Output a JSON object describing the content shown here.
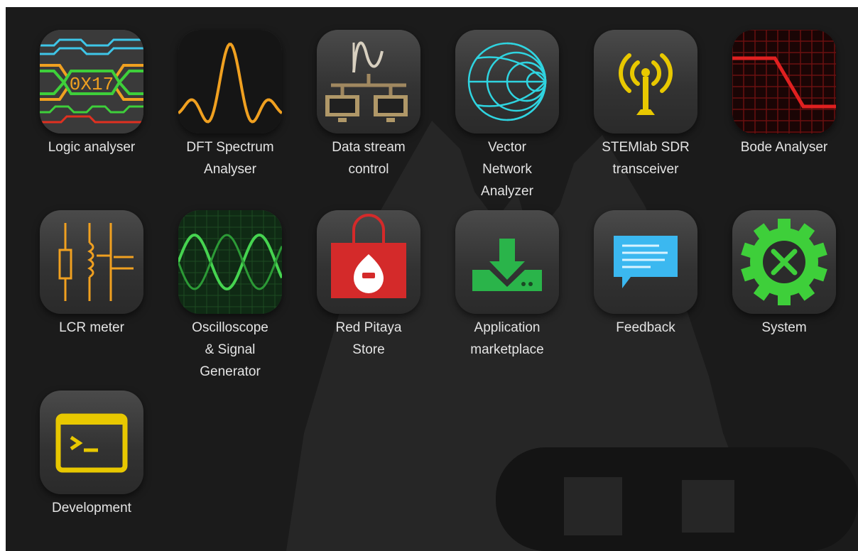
{
  "apps": [
    {
      "id": "logic-analyser",
      "label_lines": [
        "Logic analyser"
      ],
      "chip_text": "0X17"
    },
    {
      "id": "dft-spectrum-analyser",
      "label_lines": [
        "DFT Spectrum",
        "Analyser"
      ]
    },
    {
      "id": "data-stream-control",
      "label_lines": [
        "Data stream",
        "control"
      ]
    },
    {
      "id": "vector-network-analyzer",
      "label_lines": [
        "Vector",
        "Network",
        "Analyzer"
      ]
    },
    {
      "id": "stemlab-sdr-transceiver",
      "label_lines": [
        "STEMlab SDR",
        "transceiver"
      ]
    },
    {
      "id": "bode-analyser",
      "label_lines": [
        "Bode Analyser"
      ]
    },
    {
      "id": "lcr-meter",
      "label_lines": [
        "LCR meter"
      ]
    },
    {
      "id": "oscilloscope-signal-generator",
      "label_lines": [
        "Oscilloscope",
        "& Signal",
        "Generator"
      ]
    },
    {
      "id": "red-pitaya-store",
      "label_lines": [
        "Red Pitaya",
        "Store"
      ]
    },
    {
      "id": "application-marketplace",
      "label_lines": [
        "Application",
        "marketplace"
      ]
    },
    {
      "id": "feedback",
      "label_lines": [
        "Feedback"
      ]
    },
    {
      "id": "system",
      "label_lines": [
        "System"
      ]
    },
    {
      "id": "development",
      "label_lines": [
        "Development"
      ]
    }
  ],
  "icons": {
    "logic-analyser": "logic-waveform-icon",
    "dft-spectrum-analyser": "sinc-spectrum-icon",
    "data-stream-control": "network-stream-icon",
    "vector-network-analyzer": "smith-chart-icon",
    "stemlab-sdr-transceiver": "antenna-icon",
    "bode-analyser": "bode-plot-icon",
    "lcr-meter": "circuit-components-icon",
    "oscilloscope-signal-generator": "oscilloscope-wave-icon",
    "red-pitaya-store": "shopping-bag-icon",
    "application-marketplace": "download-icon",
    "feedback": "speech-bubble-icon",
    "system": "gear-tools-icon",
    "development": "terminal-icon"
  },
  "colors": {
    "background": "#1b1b1b",
    "label": "#e4e4e4",
    "orange": "#f0a020",
    "cyan": "#2fd4e0",
    "yellow": "#e8c800",
    "red": "#e02020",
    "green": "#3ecf3a",
    "store_red": "#d42a2a",
    "download_green": "#2ab44a",
    "feedback_blue": "#3bb8f0"
  }
}
